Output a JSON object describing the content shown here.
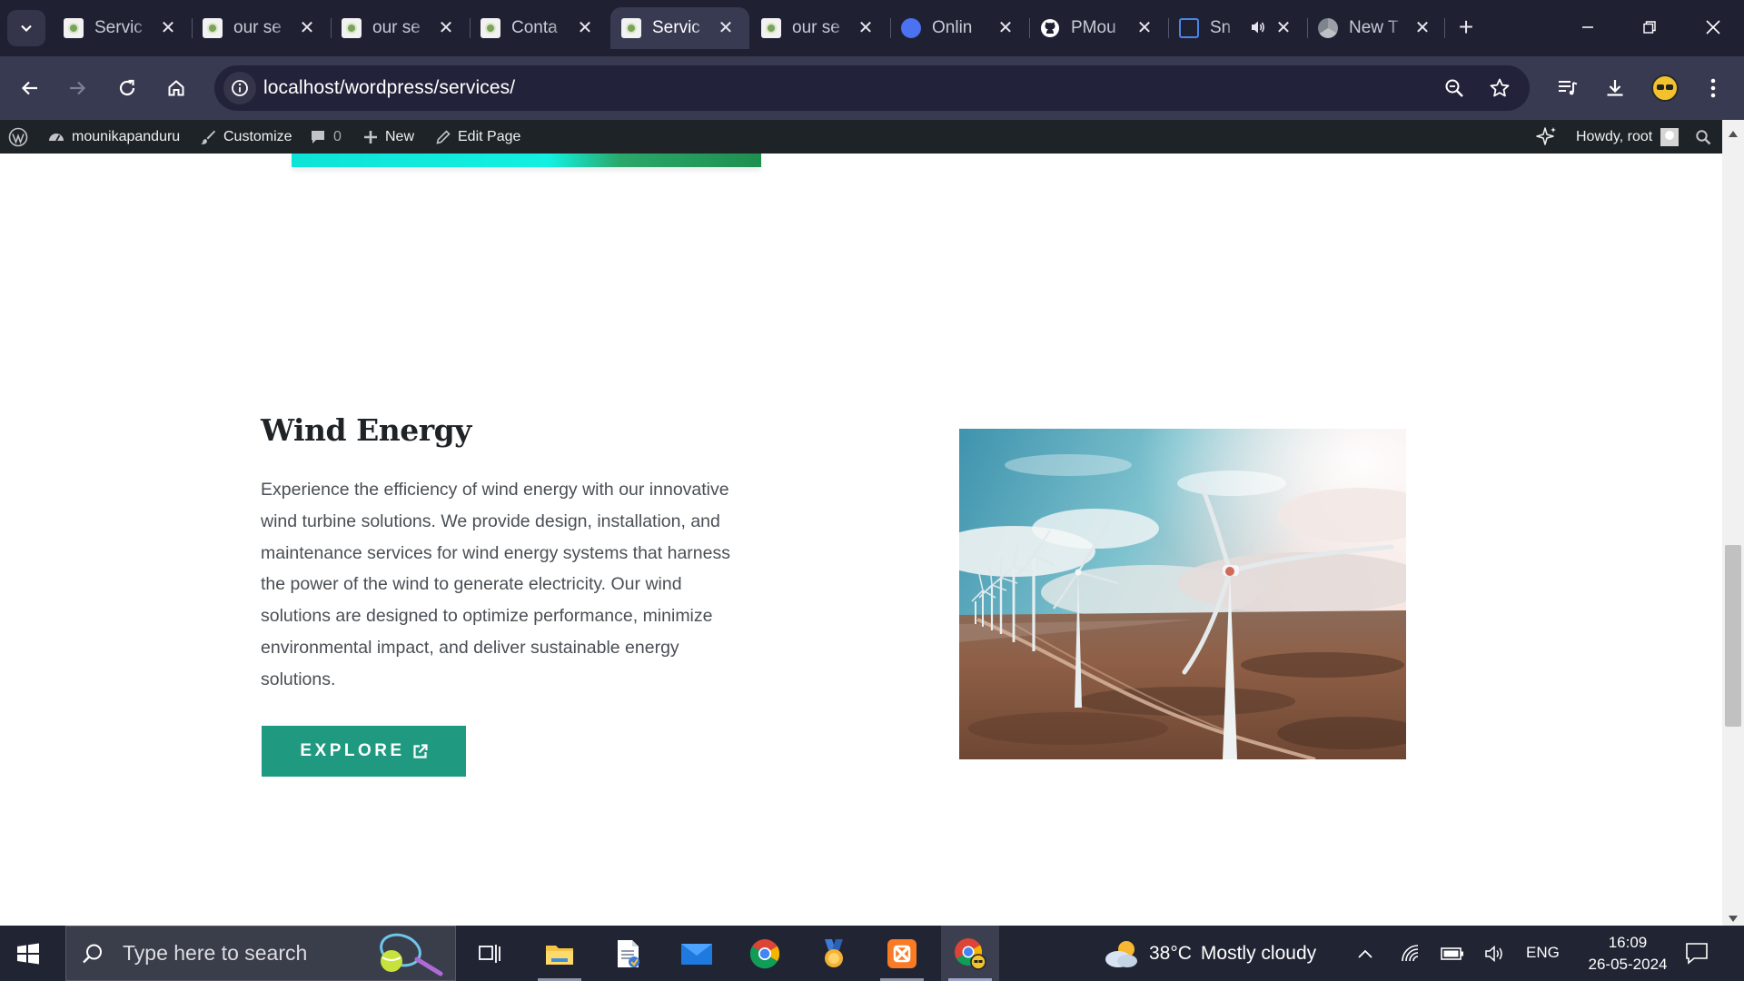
{
  "browser": {
    "tabs": [
      {
        "title": "Servic",
        "icon": "site-favicon",
        "active": false
      },
      {
        "title": "our se",
        "icon": "site-favicon",
        "active": false
      },
      {
        "title": "our se",
        "icon": "site-favicon",
        "active": false
      },
      {
        "title": "Conta",
        "icon": "site-favicon",
        "active": false
      },
      {
        "title": "Servic",
        "icon": "site-favicon",
        "active": true
      },
      {
        "title": "our se",
        "icon": "site-favicon",
        "active": false
      },
      {
        "title": "Onlin",
        "icon": "online-tool-favicon",
        "active": false
      },
      {
        "title": "PMou",
        "icon": "github-icon",
        "active": false
      },
      {
        "title": "Sn",
        "icon": "snipping-favicon",
        "active": false,
        "audio": true
      },
      {
        "title": "New T",
        "icon": "chrome-icon",
        "active": false
      }
    ],
    "url": "localhost/wordpress/services/"
  },
  "wp_admin_bar": {
    "site_name": "mounikapanduru",
    "customize": "Customize",
    "comments_count": "0",
    "new": "New",
    "edit_page": "Edit Page",
    "greeting": "Howdy, root"
  },
  "section": {
    "title": "Wind Energy",
    "body": "Experience the efficiency of wind energy with our innovative wind turbine solutions. We provide design, installation, and maintenance services for wind energy systems that harness the power of the wind to generate electricity. Our wind solutions are designed to optimize performance, minimize environmental impact, and deliver sustainable energy solutions.",
    "button_label": "EXPLORE",
    "button_color": "#1f9a80"
  },
  "taskbar": {
    "search_placeholder": "Type here to search",
    "weather_temp": "38°C",
    "weather_text": "Mostly cloudy",
    "language": "ENG",
    "time": "16:09",
    "date": "26-05-2024"
  }
}
